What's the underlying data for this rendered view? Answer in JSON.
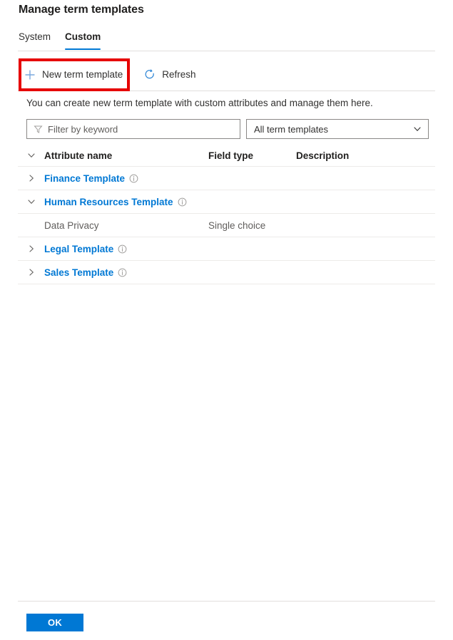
{
  "page": {
    "title": "Manage term templates"
  },
  "tabs": [
    {
      "label": "System",
      "active": false
    },
    {
      "label": "Custom",
      "active": true
    }
  ],
  "toolbar": {
    "new_template_label": "New term template",
    "new_template_icon": "plus-icon",
    "refresh_label": "Refresh",
    "refresh_icon": "refresh-icon",
    "highlight_color": "#e60000"
  },
  "description": "You can create new term template with custom attributes and manage them here.",
  "filter": {
    "placeholder": "Filter by keyword",
    "value": "",
    "icon": "filter-funnel-icon"
  },
  "template_select": {
    "selected": "All term templates",
    "icon": "chevron-down-icon",
    "options": [
      "All term templates"
    ]
  },
  "table": {
    "headers": {
      "attribute_name": "Attribute name",
      "field_type": "Field type",
      "description": "Description"
    },
    "header_caret_icon": "chevron-down-icon",
    "rows": [
      {
        "name": "Finance Template",
        "field_type": "",
        "description": "",
        "expanded": false,
        "caret_icon": "chevron-right-icon",
        "info_icon": "info-icon",
        "is_child": false
      },
      {
        "name": "Human Resources Template",
        "field_type": "",
        "description": "",
        "expanded": true,
        "caret_icon": "chevron-down-icon",
        "info_icon": "info-icon",
        "is_child": false
      },
      {
        "name": "Data Privacy",
        "field_type": "Single choice",
        "description": "",
        "expanded": false,
        "caret_icon": "",
        "info_icon": "",
        "is_child": true
      },
      {
        "name": "Legal Template",
        "field_type": "",
        "description": "",
        "expanded": false,
        "caret_icon": "chevron-right-icon",
        "info_icon": "info-icon",
        "is_child": false
      },
      {
        "name": "Sales Template",
        "field_type": "",
        "description": "",
        "expanded": false,
        "caret_icon": "chevron-right-icon",
        "info_icon": "info-icon",
        "is_child": false
      }
    ]
  },
  "footer": {
    "ok_label": "OK",
    "ok_color": "#0078d4"
  }
}
